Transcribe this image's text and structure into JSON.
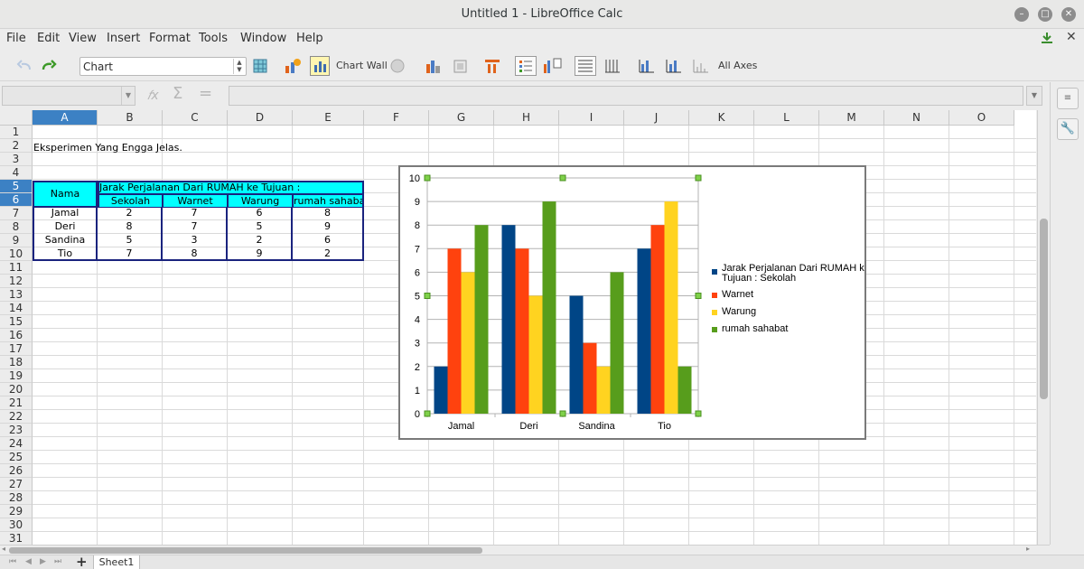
{
  "window": {
    "title": "Untitled 1 - LibreOffice Calc"
  },
  "menu": [
    "File",
    "Edit",
    "View",
    "Insert",
    "Format",
    "Tools",
    "Window",
    "Help"
  ],
  "toolbar": {
    "chart_type_value": "Chart",
    "chart_wall_label": "Chart Wall",
    "all_axes_label": "All Axes"
  },
  "formula": {
    "name_box": "",
    "input": ""
  },
  "columns": [
    "A",
    "B",
    "C",
    "D",
    "E",
    "F",
    "G",
    "H",
    "I",
    "J",
    "K",
    "L",
    "M",
    "N",
    "O"
  ],
  "rows": [
    "1",
    "2",
    "3",
    "4",
    "5",
    "6",
    "7",
    "8",
    "9",
    "10",
    "11",
    "12",
    "13",
    "14",
    "15",
    "16",
    "17",
    "18",
    "19",
    "20",
    "21",
    "22",
    "23",
    "24",
    "25",
    "26",
    "27",
    "28",
    "29",
    "30",
    "31"
  ],
  "sheet": {
    "a2": "Eksperimen Yang Engga Jelas.",
    "nama_header": "Nama",
    "group_header": "Jarak Perjalanan Dari RUMAH ke Tujuan :",
    "subheaders": [
      "Sekolah",
      "Warnet",
      "Warung",
      "rumah sahabat"
    ],
    "data": [
      {
        "name": "Jamal",
        "values": [
          "2",
          "7",
          "6",
          "8"
        ]
      },
      {
        "name": "Deri",
        "values": [
          "8",
          "7",
          "5",
          "9"
        ]
      },
      {
        "name": "Sandina",
        "values": [
          "5",
          "3",
          "2",
          "6"
        ]
      },
      {
        "name": "Tio",
        "values": [
          "7",
          "8",
          "9",
          "2"
        ]
      }
    ]
  },
  "chart_data": {
    "type": "bar",
    "categories": [
      "Jamal",
      "Deri",
      "Sandina",
      "Tio"
    ],
    "series": [
      {
        "name": "Jarak Perjalanan Dari RUMAH ke Tujuan : Sekolah",
        "values": [
          2,
          8,
          5,
          7
        ],
        "color": "#004586"
      },
      {
        "name": "Warnet",
        "values": [
          7,
          7,
          3,
          8
        ],
        "color": "#ff420e"
      },
      {
        "name": "Warung",
        "values": [
          6,
          5,
          2,
          9
        ],
        "color": "#ffd320"
      },
      {
        "name": "rumah sahabat",
        "values": [
          8,
          9,
          6,
          2
        ],
        "color": "#579d1c"
      }
    ],
    "yticks": [
      "0",
      "1",
      "2",
      "3",
      "4",
      "5",
      "6",
      "7",
      "8",
      "9",
      "10"
    ],
    "ylim": [
      0,
      10
    ],
    "grid": true,
    "legend": "right"
  },
  "tabs": {
    "sheet1": "Sheet1",
    "add": "+"
  }
}
